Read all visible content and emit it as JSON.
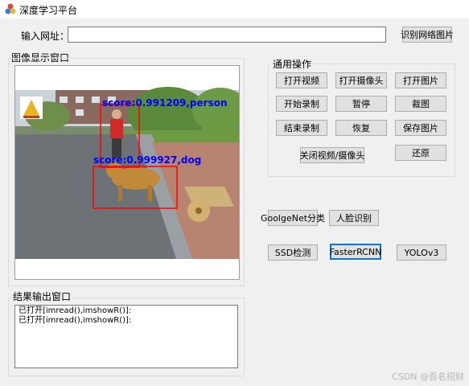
{
  "window": {
    "title": "深度学习平台"
  },
  "url_bar": {
    "label": "输入网址：",
    "value": "",
    "recognize_button": "识别网络图片"
  },
  "image_display": {
    "label": "图像显示窗口",
    "detections": [
      {
        "label": "score:0.991209,person"
      },
      {
        "label": "score:0.999927,dog"
      }
    ]
  },
  "common_ops": {
    "label": "通用操作",
    "buttons": {
      "open_video": "打开视频",
      "open_camera": "打开摄像头",
      "open_image": "打开图片",
      "start_record": "开始录制",
      "pause": "暂停",
      "crop": "裁图",
      "stop_record": "结束录制",
      "resume": "恢复",
      "save_image": "保存图片",
      "close_video_camera": "关闭视频/摄像头",
      "restore": "还原"
    }
  },
  "models": {
    "googlenet": "GoolgeNet分类",
    "face": "人脸识别",
    "ssd": "SSD检测",
    "fasterrcnn": "FasterRCNN",
    "yolo": "YOLOv3"
  },
  "output": {
    "label": "结果输出窗口",
    "lines": [
      "已打开[imread(),imshowR()]:",
      "已打开[imread(),imshowR()]:"
    ]
  },
  "watermark": "CSDN @吾名招财",
  "colors": {
    "box": "#ff0000",
    "detection_text": "#0000ff",
    "focus": "#0078d7"
  }
}
